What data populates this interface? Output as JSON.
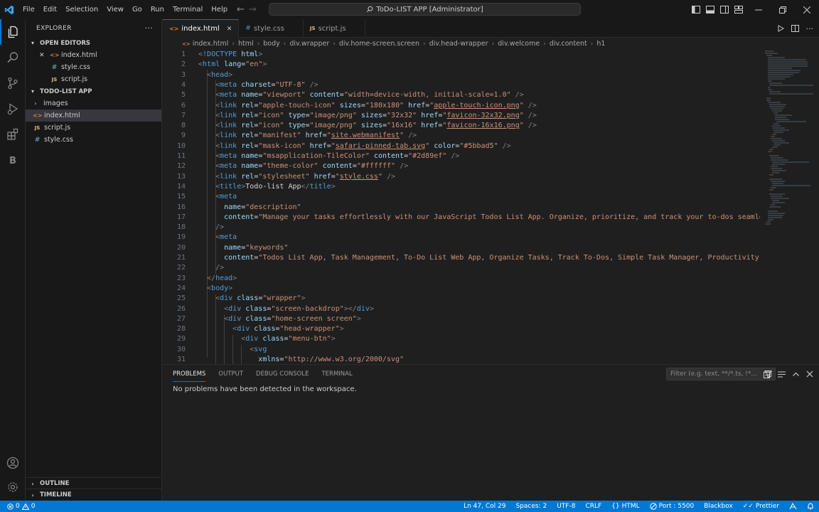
{
  "titlebar": {
    "menu": [
      "File",
      "Edit",
      "Selection",
      "View",
      "Go",
      "Run",
      "Terminal",
      "Help"
    ],
    "command_center": "ToDo-LIST APP [Administrator]"
  },
  "sidebar": {
    "title": "EXPLORER",
    "more": "···",
    "open_editors_label": "OPEN EDITORS",
    "open_editors": [
      {
        "icon": "<>",
        "name": "index.html",
        "close": "✕"
      },
      {
        "icon": "#",
        "name": "style.css"
      },
      {
        "icon": "JS",
        "name": "script.js"
      }
    ],
    "project_label": "TODO-LIST APP",
    "files": [
      {
        "name": "images",
        "type": "folder"
      },
      {
        "icon": "<>",
        "name": "index.html"
      },
      {
        "icon": "JS",
        "name": "script.js"
      },
      {
        "icon": "#",
        "name": "style.css"
      }
    ],
    "outline_label": "OUTLINE",
    "timeline_label": "TIMELINE"
  },
  "tabs": [
    {
      "icon": "<>",
      "label": "index.html",
      "close": "✕",
      "active": true
    },
    {
      "icon": "#",
      "label": "style.css"
    },
    {
      "icon": "JS",
      "label": "script.js"
    }
  ],
  "breadcrumbs": [
    "index.html",
    "html",
    "body",
    "div.wrapper",
    "div.home-screen.screen",
    "div.head-wrapper",
    "div.welcome",
    "div.content",
    "h1"
  ],
  "code_lines": [
    "1",
    "2",
    "3",
    "4",
    "5",
    "6",
    "7",
    "8",
    "9",
    "10",
    "11",
    "12",
    "13",
    "14",
    "15",
    "16",
    "17",
    "18",
    "19",
    "20",
    "21",
    "22",
    "23",
    "24",
    "25",
    "26",
    "27",
    "28",
    "29",
    "30",
    "31"
  ],
  "panel": {
    "tabs": [
      "PROBLEMS",
      "OUTPUT",
      "DEBUG CONSOLE",
      "TERMINAL"
    ],
    "filter_placeholder": "Filter (e.g. text, **/*.ts, !*...",
    "message": "No problems have been detected in the workspace."
  },
  "statusbar": {
    "errors": "0",
    "warnings": "0",
    "position": "Ln 47, Col 29",
    "spaces": "Spaces: 2",
    "encoding": "UTF-8",
    "eol": "CRLF",
    "language": "HTML",
    "port": "Port : 5500",
    "blackbox": "Blackbox",
    "prettier": "Prettier"
  },
  "colors": {
    "accent": "#0078d4",
    "status_bg": "#0078d4",
    "tag": "#569cd6",
    "attr": "#9cdcfe",
    "string": "#ce9178"
  }
}
